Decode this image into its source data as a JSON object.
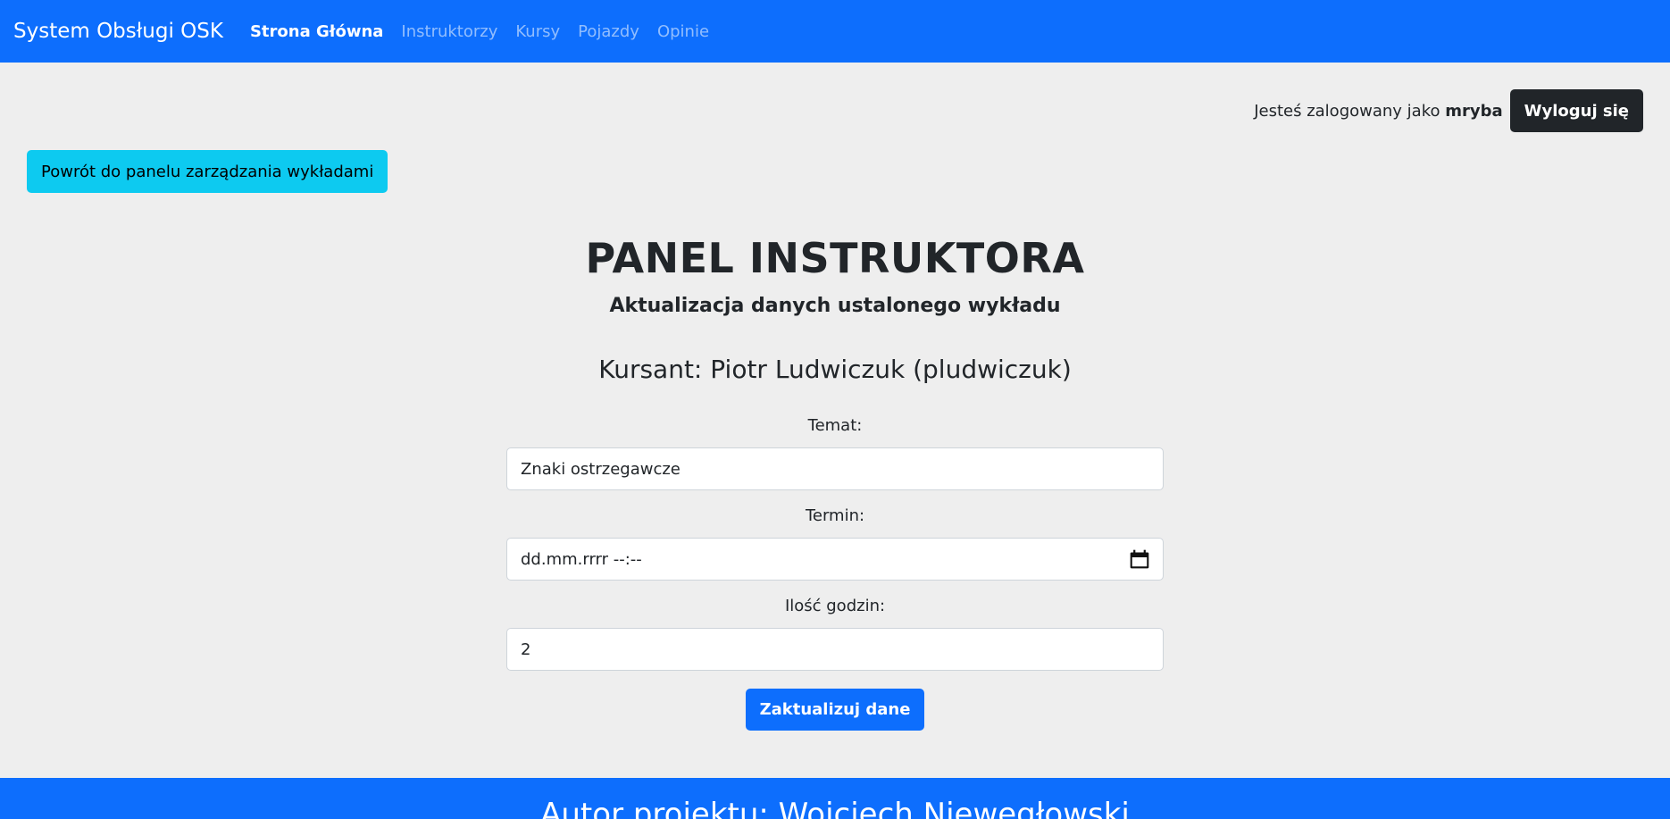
{
  "nav": {
    "brand": "System Obsługi OSK",
    "links": [
      "Strona Główna",
      "Instruktorzy",
      "Kursy",
      "Pojazdy",
      "Opinie"
    ]
  },
  "session": {
    "logged_prefix": "Jesteś zalogowany jako",
    "username": "mryba",
    "logout_label": "Wyloguj się"
  },
  "back_button": "Powrót do panelu zarządzania wykładami",
  "page": {
    "title": "PANEL INSTRUKTORA",
    "subtitle": "Aktualizacja danych ustalonego wykładu",
    "student": "Kursant: Piotr Ludwiczuk (pludwiczuk)"
  },
  "form": {
    "topic_label": "Temat:",
    "topic_value": "Znaki ostrzegawcze",
    "date_label": "Termin:",
    "date_placeholder": "dd.mm.rrrr --:--",
    "hours_label": "Ilość godzin:",
    "hours_value": "2",
    "submit_label": "Zaktualizuj dane"
  },
  "footer": {
    "text": "Autor projektu: Wojciech Niewęgłowski"
  },
  "colors": {
    "primary": "#0d6efd",
    "info": "#0dcaf0",
    "dark": "#212529",
    "background": "#eeeeee"
  }
}
